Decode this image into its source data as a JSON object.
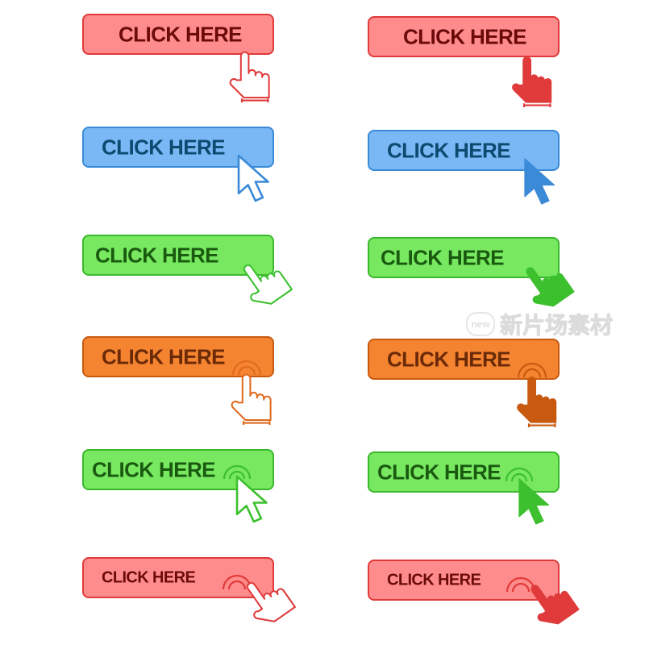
{
  "buttons": [
    {
      "label": "CLICK HERE",
      "theme": "red",
      "cursor": "hand-outline-icon",
      "cursor_color": "#e03a3a"
    },
    {
      "label": "CLICK HERE",
      "theme": "red",
      "cursor": "hand-filled-icon",
      "cursor_color": "#e03a3a"
    },
    {
      "label": "CLICK HERE",
      "theme": "blue",
      "cursor": "arrow-outline-icon",
      "cursor_color": "#3a8ad8"
    },
    {
      "label": "CLICK HERE",
      "theme": "blue",
      "cursor": "arrow-filled-icon",
      "cursor_color": "#3a8ad8"
    },
    {
      "label": "CLICK HERE",
      "theme": "green",
      "cursor": "tapping-hand-outline-icon",
      "cursor_color": "#3cc02e"
    },
    {
      "label": "CLICK HERE",
      "theme": "green",
      "cursor": "tapping-hand-filled-icon",
      "cursor_color": "#3cc02e"
    },
    {
      "label": "CLICK HERE",
      "theme": "orange",
      "cursor": "ripple-hand-outline-icon",
      "cursor_color": "#e06a20"
    },
    {
      "label": "CLICK HERE",
      "theme": "orange",
      "cursor": "ripple-hand-filled-icon",
      "cursor_color": "#c85a10"
    },
    {
      "label": "CLICK HERE",
      "theme": "green",
      "cursor": "ripple-arrow-outline-icon",
      "cursor_color": "#3cc02e"
    },
    {
      "label": "CLICK HERE",
      "theme": "green",
      "cursor": "ripple-arrow-filled-icon",
      "cursor_color": "#3cc02e"
    },
    {
      "label": "CLICK HERE",
      "theme": "red",
      "cursor": "ripple-tapping-hand-outline-icon",
      "cursor_color": "#e03a3a"
    },
    {
      "label": "CLICK HERE",
      "theme": "red",
      "cursor": "ripple-tapping-hand-filled-icon",
      "cursor_color": "#e03a3a"
    }
  ],
  "colors": {
    "red_fill": "#ff8c8c",
    "red_border": "#e03a3a",
    "red_text": "#6b0a0a",
    "blue_fill": "#7ab8f5",
    "blue_border": "#3a8ad8",
    "blue_text": "#0d4a70",
    "green_fill": "#77e860",
    "green_border": "#3cb82e",
    "green_text": "#1a5a10",
    "orange_fill": "#f58430",
    "orange_border": "#c85a10",
    "orange_text": "#6a2a08"
  },
  "watermark": {
    "logo": "new",
    "text": "新片场素材"
  }
}
